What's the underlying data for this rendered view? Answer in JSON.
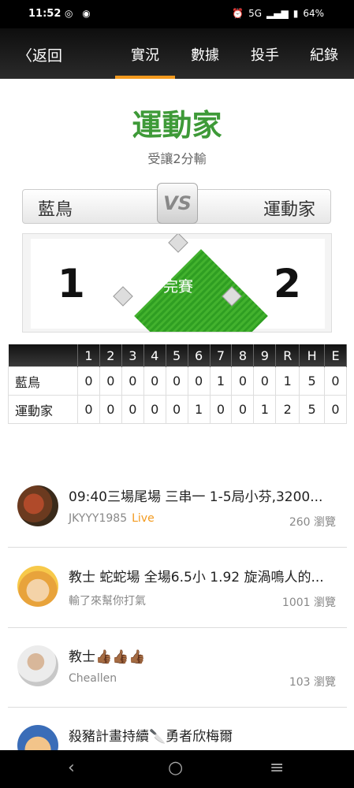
{
  "status_bar": {
    "time": "11:52",
    "network": "5G",
    "battery": "64%"
  },
  "nav": {
    "back_label": "返回",
    "tabs": [
      "實況",
      "數據",
      "投手",
      "紀錄"
    ],
    "active_tab": 0
  },
  "game": {
    "title": "運動家",
    "subtitle": "受讓2分輸",
    "away_team": "藍鳥",
    "home_team": "運動家",
    "vs_label": "VS",
    "away_score": "1",
    "home_score": "2",
    "status": "完賽"
  },
  "linescore": {
    "headers": [
      "",
      "1",
      "2",
      "3",
      "4",
      "5",
      "6",
      "7",
      "8",
      "9",
      "R",
      "H",
      "E"
    ],
    "rows": [
      [
        "藍鳥",
        "0",
        "0",
        "0",
        "0",
        "0",
        "0",
        "1",
        "0",
        "0",
        "1",
        "5",
        "0"
      ],
      [
        "運動家",
        "0",
        "0",
        "0",
        "0",
        "0",
        "1",
        "0",
        "0",
        "1",
        "2",
        "5",
        "0"
      ]
    ]
  },
  "posts": [
    {
      "title": "09:40三場尾場 三串一 1-5局小芬,3200...",
      "author": "JKYYY1985",
      "live": "Live",
      "views": "260 瀏覽",
      "avatar": "food-avatar"
    },
    {
      "title": "教士 蛇蛇場 全場6.5小 1.92 旋渦鳴人的...",
      "author": "輸了來幫你打氣",
      "live": "",
      "views": "1001 瀏覽",
      "avatar": "naruto-avatar"
    },
    {
      "title": "教士👍🏾👍🏾👍🏾",
      "author": "Cheallen",
      "live": "",
      "views": "103 瀏覽",
      "avatar": "person-avatar"
    },
    {
      "title": "殺豬計畫持續🔪勇者欣梅爾",
      "author": "",
      "live": "",
      "views": "",
      "avatar": "cartoon-avatar"
    }
  ],
  "colors": {
    "accent": "#f39a1e",
    "team_green": "#3e9a38"
  }
}
